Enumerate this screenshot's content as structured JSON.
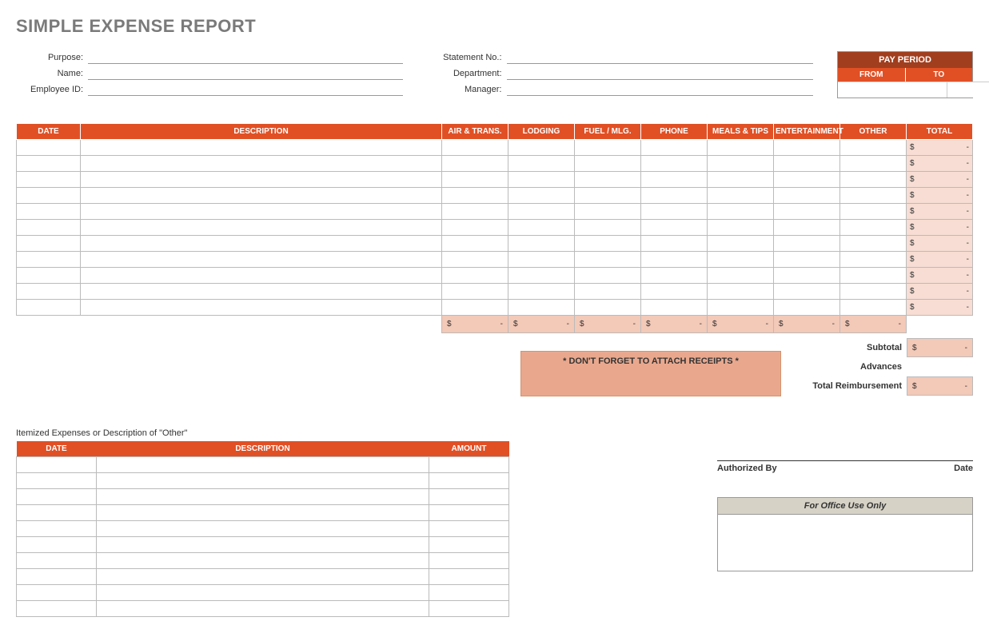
{
  "title": "SIMPLE EXPENSE REPORT",
  "fields_left": {
    "purpose_label": "Purpose:",
    "name_label": "Name:",
    "employee_id_label": "Employee ID:"
  },
  "fields_mid": {
    "statement_no_label": "Statement No.:",
    "department_label": "Department:",
    "manager_label": "Manager:"
  },
  "pay_period": {
    "title": "PAY PERIOD",
    "from": "FROM",
    "to": "TO"
  },
  "main_table": {
    "headers": [
      "DATE",
      "DESCRIPTION",
      "AIR & TRANS.",
      "LODGING",
      "FUEL / MLG.",
      "PHONE",
      "MEALS & TIPS",
      "ENTERTAINMENT",
      "OTHER",
      "TOTAL"
    ],
    "row_count": 11,
    "currency_symbol": "$",
    "empty_value": "-"
  },
  "summary": {
    "subtotal_label": "Subtotal",
    "advances_label": "Advances",
    "total_reimb_label": "Total Reimbursement"
  },
  "reminder": "* DON'T FORGET TO ATTACH RECEIPTS *",
  "itemized": {
    "title": "Itemized Expenses or Description of \"Other\"",
    "headers": [
      "DATE",
      "DESCRIPTION",
      "AMOUNT"
    ],
    "row_count": 10
  },
  "signature": {
    "authorized_by": "Authorized By",
    "date": "Date"
  },
  "office": {
    "title": "For Office Use Only"
  }
}
